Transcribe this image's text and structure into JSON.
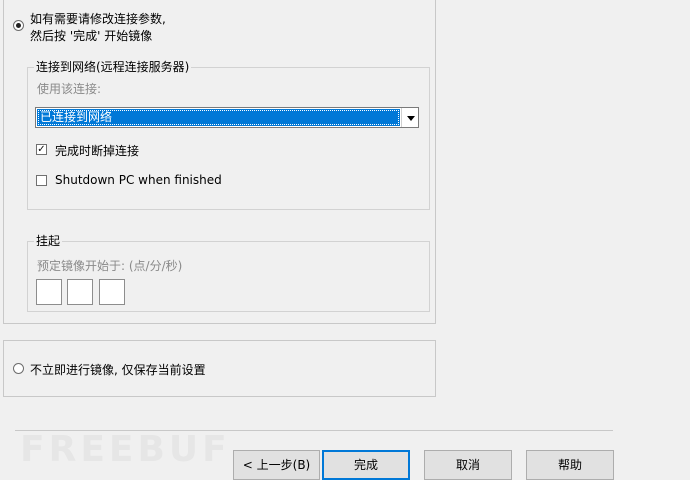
{
  "option_modify": {
    "line1": "如有需要请修改连接参数,",
    "line2": "然后按 '完成' 开始镜像",
    "selected": true
  },
  "network_group": {
    "title": "连接到网络(远程连接服务器)",
    "use_connection_label": "使用该连接:",
    "connection_value": "已连接到网络",
    "disconnect_label": "完成时断掉连接",
    "disconnect_checked": true,
    "shutdown_label": "Shutdown PC when finished",
    "shutdown_checked": false
  },
  "schedule_group": {
    "title": "挂起",
    "start_at_label": "预定镜像开始于: (点/分/秒)"
  },
  "option_save": {
    "label": "不立即进行镜像, 仅保存当前设置",
    "selected": false
  },
  "watermark": "FREEBUF",
  "buttons": {
    "back": "< 上一步(B)",
    "finish": "完成",
    "cancel": "取消",
    "help": "帮助"
  }
}
